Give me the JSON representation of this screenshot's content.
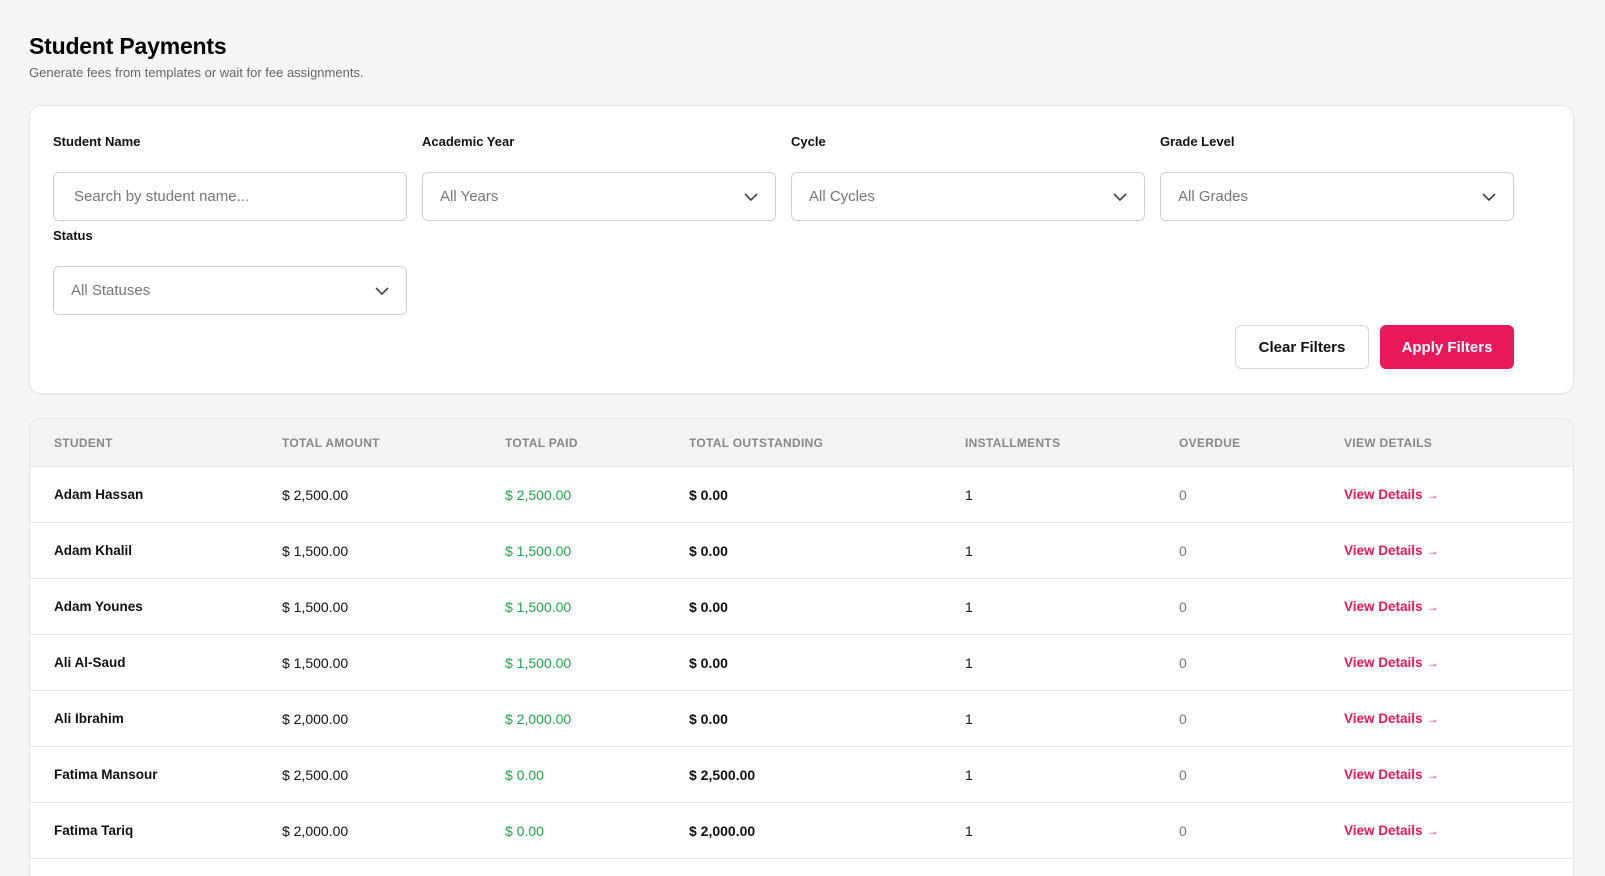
{
  "header": {
    "title": "Student Payments",
    "subtitle": "Generate fees from templates or wait for fee assignments."
  },
  "filters": {
    "student_name": {
      "label": "Student Name",
      "placeholder": "Search by student name..."
    },
    "academic_year": {
      "label": "Academic Year",
      "value": "All Years"
    },
    "cycle": {
      "label": "Cycle",
      "value": "All Cycles"
    },
    "grade_level": {
      "label": "Grade Level",
      "value": "All Grades"
    },
    "status": {
      "label": "Status",
      "value": "All Statuses"
    },
    "clear_label": "Clear Filters",
    "apply_label": "Apply Filters"
  },
  "table": {
    "columns": [
      "STUDENT",
      "TOTAL AMOUNT",
      "TOTAL PAID",
      "TOTAL OUTSTANDING",
      "INSTALLMENTS",
      "OVERDUE",
      "VIEW DETAILS"
    ],
    "view_label": "View Details",
    "view_arrow": "→",
    "rows": [
      {
        "student": "Adam Hassan",
        "amount": "$ 2,500.00",
        "paid": "$ 2,500.00",
        "outstanding": "$ 0.00",
        "installments": "1",
        "overdue": "0"
      },
      {
        "student": "Adam Khalil",
        "amount": "$ 1,500.00",
        "paid": "$ 1,500.00",
        "outstanding": "$ 0.00",
        "installments": "1",
        "overdue": "0"
      },
      {
        "student": "Adam Younes",
        "amount": "$ 1,500.00",
        "paid": "$ 1,500.00",
        "outstanding": "$ 0.00",
        "installments": "1",
        "overdue": "0"
      },
      {
        "student": "Ali Al-Saud",
        "amount": "$ 1,500.00",
        "paid": "$ 1,500.00",
        "outstanding": "$ 0.00",
        "installments": "1",
        "overdue": "0"
      },
      {
        "student": "Ali Ibrahim",
        "amount": "$ 2,000.00",
        "paid": "$ 2,000.00",
        "outstanding": "$ 0.00",
        "installments": "1",
        "overdue": "0"
      },
      {
        "student": "Fatima Mansour",
        "amount": "$ 2,500.00",
        "paid": "$ 0.00",
        "outstanding": "$ 2,500.00",
        "installments": "1",
        "overdue": "0"
      },
      {
        "student": "Fatima Tariq",
        "amount": "$ 2,000.00",
        "paid": "$ 0.00",
        "outstanding": "$ 2,000.00",
        "installments": "1",
        "overdue": "0"
      }
    ]
  },
  "colors": {
    "accent": "#e8185a",
    "paid_green": "#1ea64a",
    "background": "#f5f5f5"
  },
  "icons": {
    "dropdown": "chevron-down-icon",
    "link_arrow": "arrow-right-icon"
  }
}
